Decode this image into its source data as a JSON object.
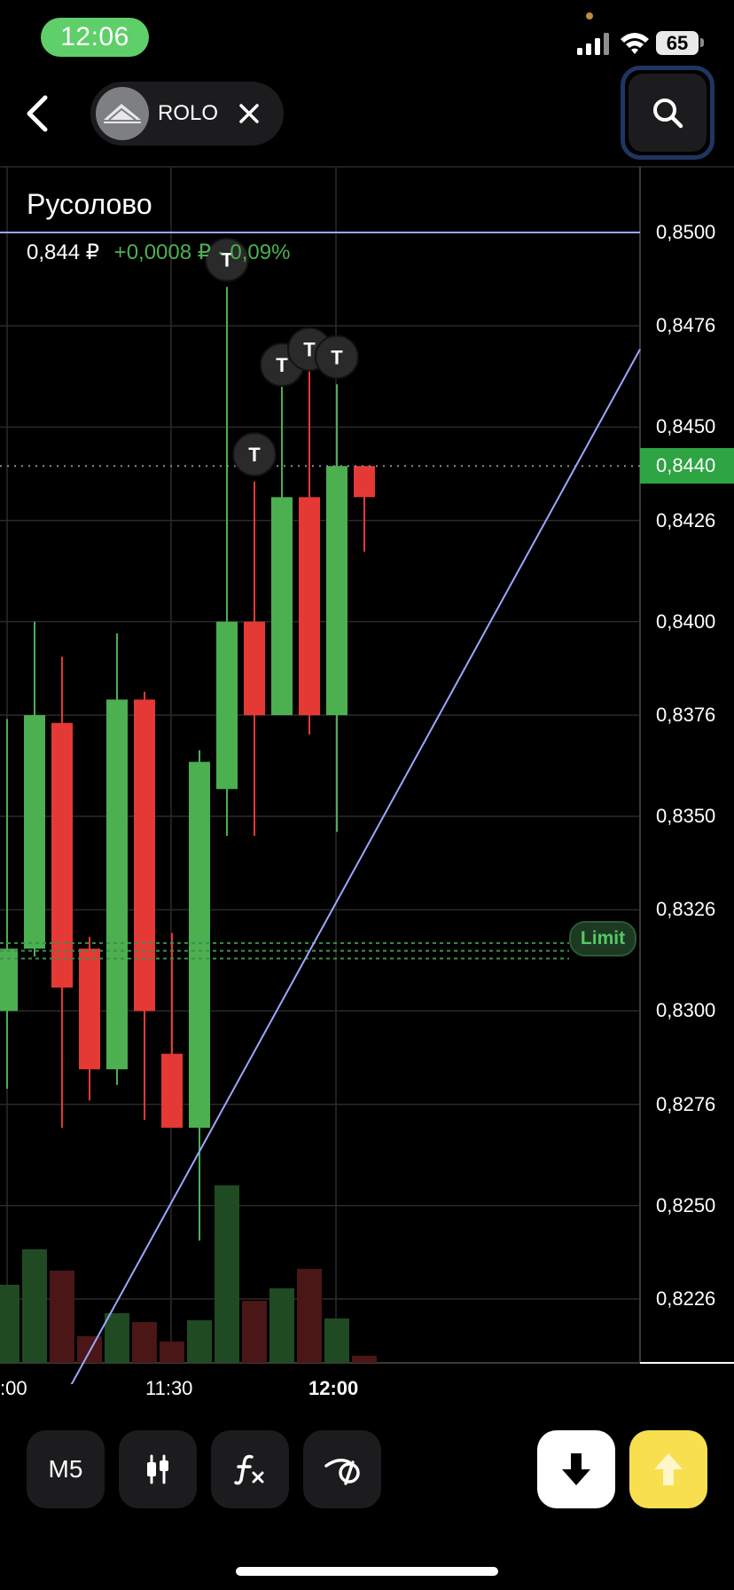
{
  "status_bar": {
    "time": "12:06",
    "battery": "65"
  },
  "header": {
    "ticker": "ROLO",
    "icons": {
      "back": "chevron-left-icon",
      "close": "close-icon",
      "search": "search-icon"
    }
  },
  "instrument": {
    "name": "Русолово",
    "price": "0,844 ₽",
    "change": "+0,0008 ₽ · 0,09%"
  },
  "colors": {
    "up": "#4caf50",
    "down": "#e53935",
    "trendline": "#9ea7ff",
    "grid": "#2a2a2a",
    "price_tag": "#2ea443",
    "buy": "#f7df4f"
  },
  "chart_data": {
    "type": "candlestick",
    "interval": "M5",
    "y_axis": {
      "ticks": [
        "0,8500",
        "0,8476",
        "0,8450",
        "0,8426",
        "0,8400",
        "0,8376",
        "0,8350",
        "0,8326",
        "0,8300",
        "0,8276",
        "0,8250",
        "0,8226"
      ],
      "range": [
        0.821,
        0.851
      ]
    },
    "x_axis": {
      "ticks": [
        ":00",
        "11:30",
        "12:00"
      ]
    },
    "current_price_label": "0,8440",
    "horizontal_line": 0.85,
    "candles": [
      {
        "o": 0.83,
        "h": 0.8375,
        "l": 0.828,
        "c": 0.8316
      },
      {
        "o": 0.8316,
        "h": 0.84,
        "l": 0.8314,
        "c": 0.8376
      },
      {
        "o": 0.8374,
        "h": 0.8391,
        "l": 0.827,
        "c": 0.8306
      },
      {
        "o": 0.8316,
        "h": 0.8319,
        "l": 0.8277,
        "c": 0.8285
      },
      {
        "o": 0.8285,
        "h": 0.8397,
        "l": 0.8281,
        "c": 0.838
      },
      {
        "o": 0.838,
        "h": 0.8382,
        "l": 0.8272,
        "c": 0.83
      },
      {
        "o": 0.8289,
        "h": 0.832,
        "l": 0.827,
        "c": 0.827
      },
      {
        "o": 0.827,
        "h": 0.8367,
        "l": 0.8241,
        "c": 0.8364
      },
      {
        "o": 0.8357,
        "h": 0.8486,
        "l": 0.8345,
        "c": 0.84
      },
      {
        "o": 0.84,
        "h": 0.8436,
        "l": 0.8345,
        "c": 0.8376
      },
      {
        "o": 0.8376,
        "h": 0.8461,
        "l": 0.8376,
        "c": 0.8432
      },
      {
        "o": 0.8432,
        "h": 0.8465,
        "l": 0.8371,
        "c": 0.8376
      },
      {
        "o": 0.8376,
        "h": 0.8461,
        "l": 0.8346,
        "c": 0.844
      },
      {
        "o": 0.844,
        "h": 0.844,
        "l": 0.8418,
        "c": 0.8432
      }
    ],
    "volumes": [
      0.44,
      0.64,
      0.52,
      0.15,
      0.28,
      0.23,
      0.12,
      0.24,
      1.0,
      0.35,
      0.42,
      0.53,
      0.25,
      0.04
    ],
    "trade_markers": [
      "T",
      "T",
      "T",
      "T",
      "T"
    ],
    "trendline": {
      "from": [
        1,
        0.821
      ],
      "to": [
        22.6,
        0.847
      ]
    },
    "limit_order": {
      "label": "Limit",
      "levels": [
        0.8322,
        0.832,
        0.8318
      ]
    }
  },
  "toolbar": {
    "interval": "M5",
    "icons": [
      "candles-icon",
      "indicators-icon",
      "drawing-icon"
    ],
    "sell_icon": "arrow-down-icon",
    "buy_icon": "arrow-up-icon"
  }
}
